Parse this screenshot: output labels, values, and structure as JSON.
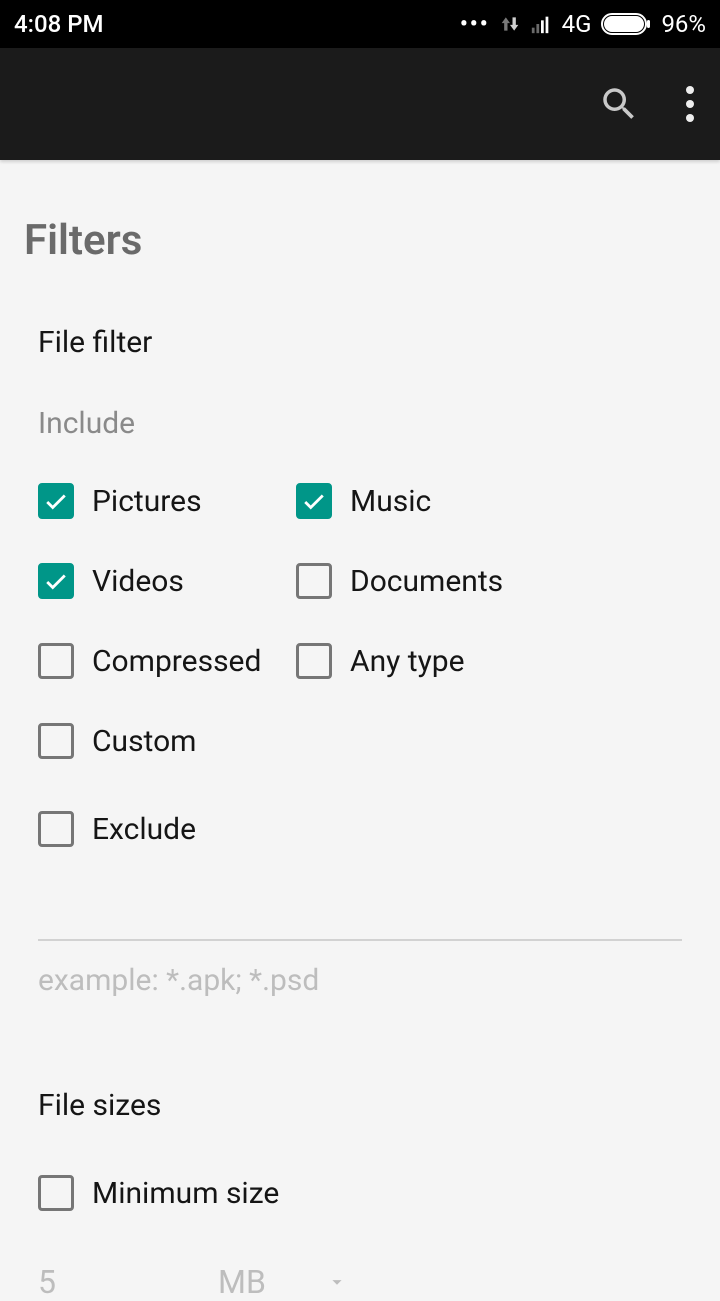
{
  "status": {
    "time": "4:08 PM",
    "network": "4G",
    "battery_pct": "96%"
  },
  "page": {
    "title": "Filters"
  },
  "file_filter": {
    "title": "File filter",
    "include_label": "Include",
    "options": {
      "pictures": {
        "label": "Pictures",
        "checked": true
      },
      "music": {
        "label": "Music",
        "checked": true
      },
      "videos": {
        "label": "Videos",
        "checked": true
      },
      "documents": {
        "label": "Documents",
        "checked": false
      },
      "compressed": {
        "label": "Compressed",
        "checked": false
      },
      "any_type": {
        "label": "Any type",
        "checked": false
      },
      "custom": {
        "label": "Custom",
        "checked": false
      },
      "exclude": {
        "label": "Exclude",
        "checked": false
      }
    },
    "custom_input_value": "",
    "custom_placeholder": "example: *.apk; *.psd"
  },
  "file_sizes": {
    "title": "File sizes",
    "minimum": {
      "label": "Minimum size",
      "checked": false,
      "value": "5",
      "unit": "MB"
    }
  }
}
